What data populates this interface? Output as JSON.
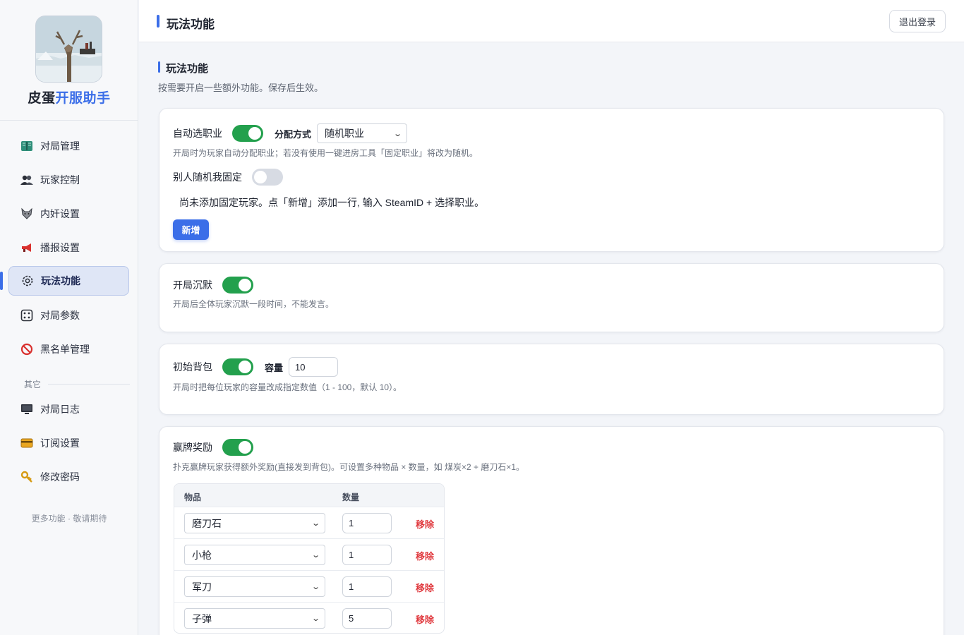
{
  "brand": {
    "part1": "皮蛋",
    "part2": "开服助手"
  },
  "sidebar": {
    "items": [
      {
        "label": "对局管理",
        "icon": "map-book-icon"
      },
      {
        "label": "玩家控制",
        "icon": "users-icon"
      },
      {
        "label": "内奸设置",
        "icon": "wolf-icon"
      },
      {
        "label": "播报设置",
        "icon": "megaphone-icon"
      },
      {
        "label": "玩法功能",
        "icon": "gear-icon"
      },
      {
        "label": "对局参数",
        "icon": "dice-icon"
      },
      {
        "label": "黑名单管理",
        "icon": "prohibited-icon"
      }
    ],
    "section_other": "其它",
    "other_items": [
      {
        "label": "对局日志",
        "icon": "monitor-icon"
      },
      {
        "label": "订阅设置",
        "icon": "card-icon"
      },
      {
        "label": "修改密码",
        "icon": "key-icon"
      }
    ],
    "more_note": "更多功能 · 敬请期待"
  },
  "header": {
    "title": "玩法功能",
    "logout": "退出登录"
  },
  "main": {
    "title": "玩法功能",
    "subtitle": "按需要开启一些额外功能。保存后生效。"
  },
  "auto_job": {
    "label": "自动选职业",
    "enabled": true,
    "mode_label": "分配方式",
    "mode_value": "随机职业",
    "desc": "开局时为玩家自动分配职业；若没有使用一键进房工具「固定职业」将改为随机。",
    "fixed_label": "别人随机我固定",
    "fixed_enabled": false,
    "empty_note": "尚未添加固定玩家。点「新增」添加一行, 输入 SteamID + 选择职业。",
    "add_button": "新增"
  },
  "silence": {
    "label": "开局沉默",
    "enabled": true,
    "desc": "开局后全体玩家沉默一段时间，不能发言。"
  },
  "backpack": {
    "label": "初始背包",
    "enabled": true,
    "cap_label": "容量",
    "cap_value": "10",
    "desc": "开局时把每位玩家的容量改成指定数值（1 - 100，默认 10）。"
  },
  "reward": {
    "label": "赢牌奖励",
    "enabled": true,
    "desc": "扑克赢牌玩家获得额外奖励(直接发到背包)。可设置多种物品 × 数量，如 煤炭×2 + 磨刀石×1。",
    "col_item": "物品",
    "col_qty": "数量",
    "remove_label": "移除",
    "rows": [
      {
        "item": "磨刀石",
        "qty": "1"
      },
      {
        "item": "小枪",
        "qty": "1"
      },
      {
        "item": "军刀",
        "qty": "1"
      },
      {
        "item": "子弹",
        "qty": "5"
      }
    ]
  },
  "colors": {
    "accent": "#3b6ee8",
    "toggle_on": "#23a04d",
    "danger": "#e0393e"
  }
}
